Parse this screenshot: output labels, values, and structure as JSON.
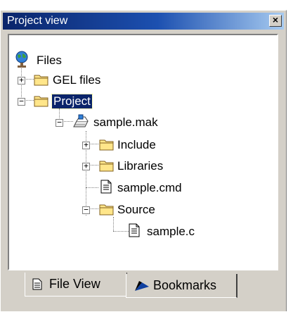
{
  "window": {
    "title": "Project view",
    "close_glyph": "×"
  },
  "tree": {
    "root": {
      "label": "Files",
      "icon": "globe-icon"
    },
    "items": [
      {
        "label": "GEL files",
        "icon": "folder-icon",
        "expander": "+"
      },
      {
        "label": "Project",
        "icon": "folder-icon",
        "expander": "−",
        "selected": true
      },
      {
        "label": "sample.mak",
        "icon": "project-file-icon",
        "expander": "−"
      },
      {
        "label": "Include",
        "icon": "folder-icon",
        "expander": "+"
      },
      {
        "label": "Libraries",
        "icon": "folder-icon",
        "expander": "+"
      },
      {
        "label": "sample.cmd",
        "icon": "document-icon"
      },
      {
        "label": "Source",
        "icon": "folder-icon",
        "expander": "−"
      },
      {
        "label": "sample.c",
        "icon": "document-icon"
      }
    ]
  },
  "tabs": [
    {
      "label": "File View",
      "icon": "document-icon",
      "active": true
    },
    {
      "label": "Bookmarks",
      "icon": "bookmark-icon",
      "active": false
    }
  ],
  "colors": {
    "selection": "#0a246a",
    "title_start": "#0a246a",
    "title_end": "#a6caf0",
    "folder": "#ffe68a"
  }
}
